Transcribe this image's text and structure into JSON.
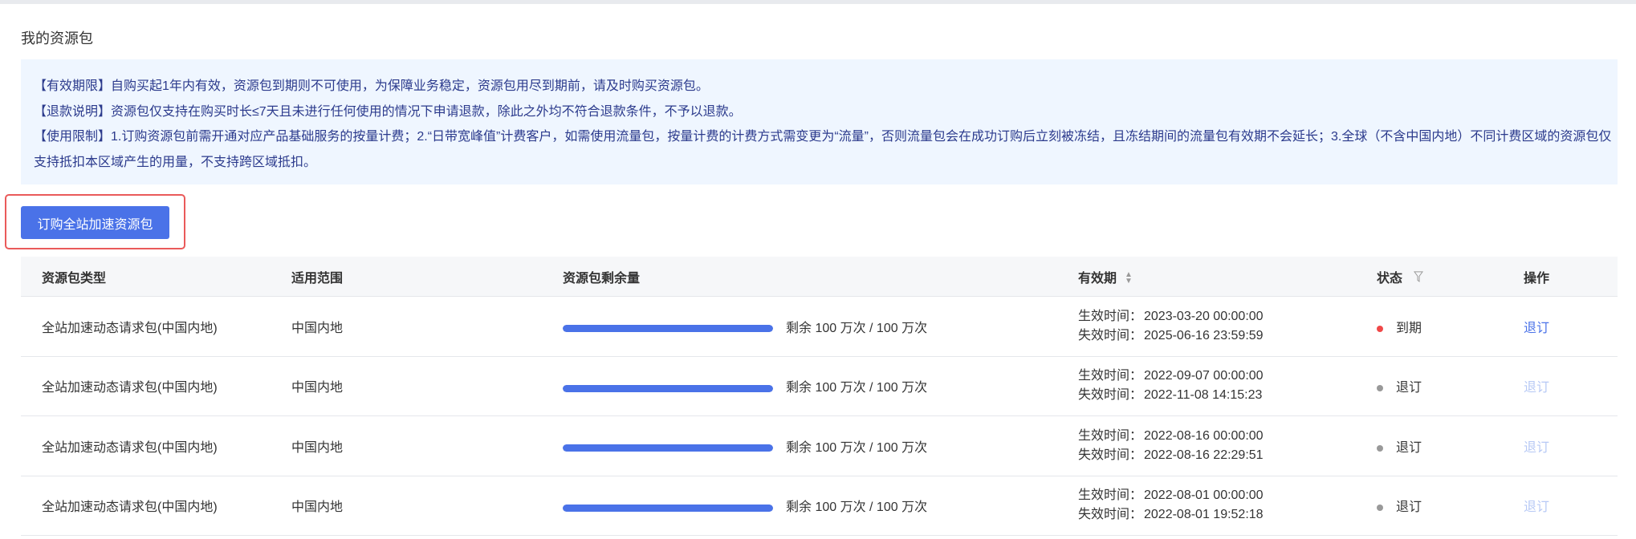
{
  "page_title": "我的资源包",
  "notice": [
    "【有效期限】自购买起1年内有效，资源包到期则不可使用，为保障业务稳定，资源包用尽到期前，请及时购买资源包。",
    "【退款说明】资源包仅支持在购买时长≤7天且未进行任何使用的情况下申请退款，除此之外均不符合退款条件，不予以退款。",
    "【使用限制】1.订购资源包前需开通对应产品基础服务的按量计费；2.“日带宽峰值”计费客户，如需使用流量包，按量计费的计费方式需变更为“流量”，否则流量包会在成功订购后立刻被冻结，且冻结期间的流量包有效期不会延长；3.全球（不含中国内地）不同计费区域的资源包仅",
    "支持抵扣本区域产生的用量，不支持跨区域抵扣。"
  ],
  "buy_button": "订购全站加速资源包",
  "columns": {
    "type": "资源包类型",
    "scope": "适用范围",
    "remaining": "资源包剩余量",
    "validity": "有效期",
    "status": "状态",
    "action": "操作"
  },
  "labels": {
    "start": "生效时间：",
    "end": "失效时间："
  },
  "colors": {
    "accent": "#4a72e8",
    "expired": "#f04848",
    "unsubscribed": "#999999"
  },
  "rows": [
    {
      "type": "全站加速动态请求包(中国内地)",
      "scope": "中国内地",
      "remaining_pct": 100,
      "remaining_text": "剩余 100 万次 / 100 万次",
      "start": "2023-03-20 00:00:00",
      "end": "2025-06-16 23:59:59",
      "status": "到期",
      "status_color": "#f04848",
      "action": "退订",
      "action_enabled": true
    },
    {
      "type": "全站加速动态请求包(中国内地)",
      "scope": "中国内地",
      "remaining_pct": 100,
      "remaining_text": "剩余 100 万次 / 100 万次",
      "start": "2022-09-07 00:00:00",
      "end": "2022-11-08 14:15:23",
      "status": "退订",
      "status_color": "#999999",
      "action": "退订",
      "action_enabled": false
    },
    {
      "type": "全站加速动态请求包(中国内地)",
      "scope": "中国内地",
      "remaining_pct": 100,
      "remaining_text": "剩余 100 万次 / 100 万次",
      "start": "2022-08-16 00:00:00",
      "end": "2022-08-16 22:29:51",
      "status": "退订",
      "status_color": "#999999",
      "action": "退订",
      "action_enabled": false
    },
    {
      "type": "全站加速动态请求包(中国内地)",
      "scope": "中国内地",
      "remaining_pct": 100,
      "remaining_text": "剩余 100 万次 / 100 万次",
      "start": "2022-08-01 00:00:00",
      "end": "2022-08-01 19:52:18",
      "status": "退订",
      "status_color": "#999999",
      "action": "退订",
      "action_enabled": false
    }
  ]
}
